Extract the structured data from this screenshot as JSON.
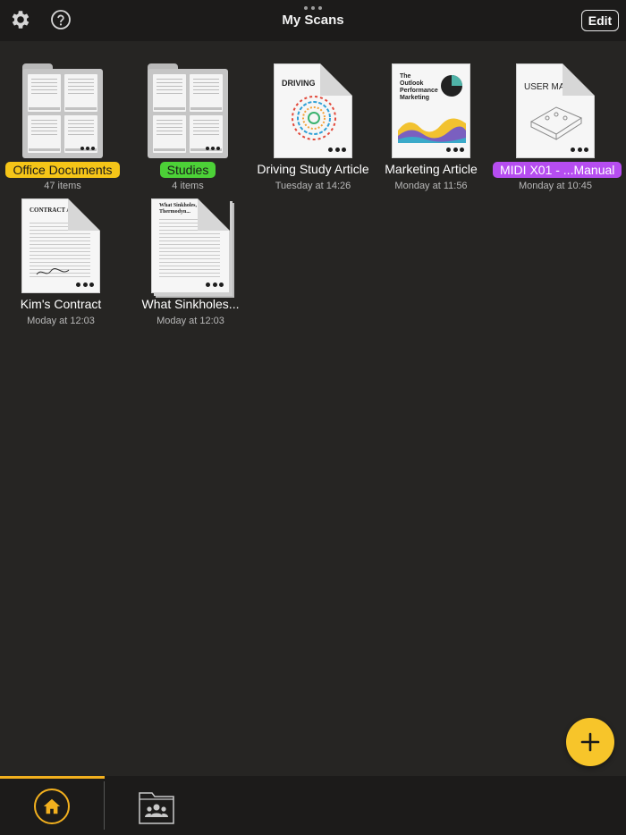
{
  "header": {
    "title": "My Scans",
    "edit_label": "Edit",
    "icons": {
      "settings": "gear-icon",
      "help": "help-icon",
      "more": "more-dots-icon"
    }
  },
  "items": [
    {
      "name": "Office Documents",
      "subtitle": "47 items",
      "kind": "folder",
      "tag_color": "#f5c518"
    },
    {
      "name": "Studies",
      "subtitle": "4 items",
      "kind": "folder",
      "tag_color": "#4cd137"
    },
    {
      "name": "Driving Study Article",
      "subtitle": "Tuesday at 14:26",
      "kind": "document",
      "thumb_title": "DRIVING"
    },
    {
      "name": "Marketing Article",
      "subtitle": "Monday at 11:56",
      "kind": "document",
      "thumb_title": "The Outlook Performance Marketing"
    },
    {
      "name": "MIDI X01 - ...Manual",
      "subtitle": "Monday at 10:45",
      "kind": "document",
      "tag_color": "#b64df0",
      "thumb_title": "USER MANUAL"
    },
    {
      "name": "Kim's Contract",
      "subtitle": "Moday at 12:03",
      "kind": "document",
      "thumb_title": "CONTRACT AGREE"
    },
    {
      "name": "What Sinkholes...",
      "subtitle": "Moday at 12:03",
      "kind": "document",
      "thumb_title": "What Sinkholes, Thermodyn..."
    }
  ],
  "fab": {
    "icon": "plus-icon"
  },
  "tabbar": {
    "tabs": [
      {
        "name": "home",
        "icon": "home-icon",
        "active": true
      },
      {
        "name": "shared",
        "icon": "shared-folder-icon",
        "active": false
      }
    ]
  },
  "colors": {
    "accent": "#f7c52a",
    "background": "#262523",
    "bar": "#1c1b1a"
  }
}
